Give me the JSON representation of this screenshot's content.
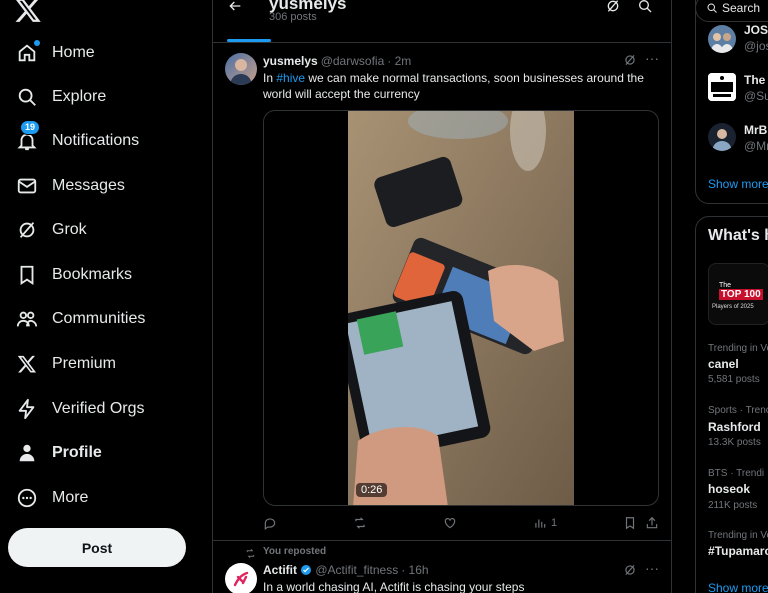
{
  "nav": {
    "items": [
      {
        "label": "Home",
        "icon": "home-icon"
      },
      {
        "label": "Explore",
        "icon": "search-icon"
      },
      {
        "label": "Notifications",
        "icon": "bell-icon",
        "badge": "19"
      },
      {
        "label": "Messages",
        "icon": "envelope-icon"
      },
      {
        "label": "Grok",
        "icon": "grok-icon"
      },
      {
        "label": "Bookmarks",
        "icon": "bookmark-icon"
      },
      {
        "label": "Communities",
        "icon": "people-icon"
      },
      {
        "label": "Premium",
        "icon": "x-logo-icon"
      },
      {
        "label": "Verified Orgs",
        "icon": "lightning-icon"
      },
      {
        "label": "Profile",
        "icon": "person-icon"
      },
      {
        "label": "More",
        "icon": "more-circle-icon"
      }
    ],
    "post_button": "Post"
  },
  "header": {
    "title": "yusmelys",
    "subtitle": "306 posts"
  },
  "post1": {
    "name": "yusmelys",
    "handle": "@darwsofia",
    "time": "· 2m",
    "text_prefix": "In ",
    "hashtag": "#hive",
    "text_suffix": " we can make normal transactions, soon businesses around the world will accept the currency",
    "video_duration": "0:26",
    "views": "1"
  },
  "repost": {
    "label": "You reposted",
    "name": "Actifit",
    "handle": "@Actifit_fitness",
    "time": "· 16h",
    "text": "In a world chasing AI, Actifit is chasing your steps"
  },
  "right": {
    "search_placeholder": "Search",
    "who_to_follow": [
      {
        "name": "JOS",
        "handle": "@jos"
      },
      {
        "name": "The",
        "handle": "@Su"
      },
      {
        "name": "MrB",
        "handle": "@Mr"
      }
    ],
    "show_more": "Show more",
    "trends_title": "What's h",
    "trends": [
      {
        "meta": "Trending in Ve",
        "name": "canel",
        "count": "5,581 posts"
      },
      {
        "meta": "Sports · Trenc",
        "name": "Rashford",
        "count": "13.3K posts"
      },
      {
        "meta": "BTS · Trendi",
        "name": "hoseok",
        "count": "211K posts"
      },
      {
        "meta": "Trending in Ve",
        "name": "#Tupamaro",
        "count": ""
      }
    ],
    "show_more_2": "Show more",
    "top100_line1": "The",
    "top100_line2": "TOP 100",
    "top100_line3": "Players of 2025"
  },
  "colors": {
    "accent": "#1d9bf0",
    "background": "#000000",
    "border": "#2f3336",
    "muted": "#71767b",
    "verified": "#1d9bf0"
  }
}
